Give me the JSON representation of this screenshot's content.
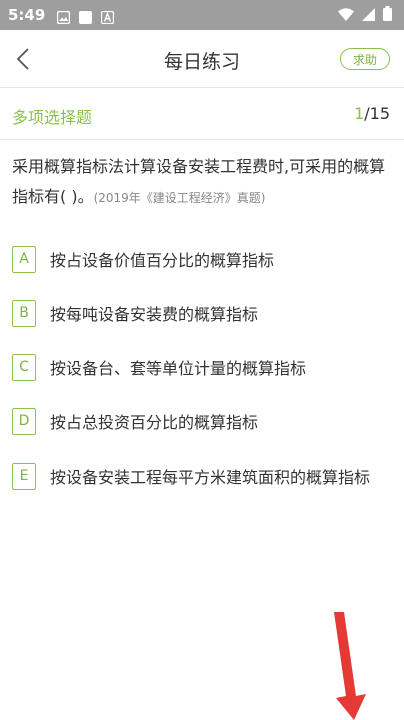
{
  "status_bar": {
    "time": "5:49"
  },
  "header": {
    "title": "每日练习",
    "help_label": "求助"
  },
  "question_meta": {
    "type_label": "多项选择题",
    "current": "1",
    "total": "/15"
  },
  "question": {
    "text": "采用概算指标法计算设备安装工程费时,可采用的概算指标有( )。",
    "source": "(2019年《建设工程经济》真题)"
  },
  "options": [
    {
      "letter": "A",
      "text": "按占设备价值百分比的概算指标"
    },
    {
      "letter": "B",
      "text": "按每吨设备安装费的概算指标"
    },
    {
      "letter": "C",
      "text": "按设备台、套等单位计量的概算指标"
    },
    {
      "letter": "D",
      "text": "按占总投资百分比的概算指标"
    },
    {
      "letter": "E",
      "text": "按设备安装工程每平方米建筑面积的概算指标"
    }
  ],
  "colors": {
    "accent": "#8bc34a",
    "status_bar": "#9e9e9e",
    "arrow": "#e53935"
  },
  "icons": [
    "image-icon",
    "square-icon",
    "a-icon",
    "wifi-icon",
    "signal-icon",
    "battery-icon",
    "back-arrow-icon"
  ]
}
